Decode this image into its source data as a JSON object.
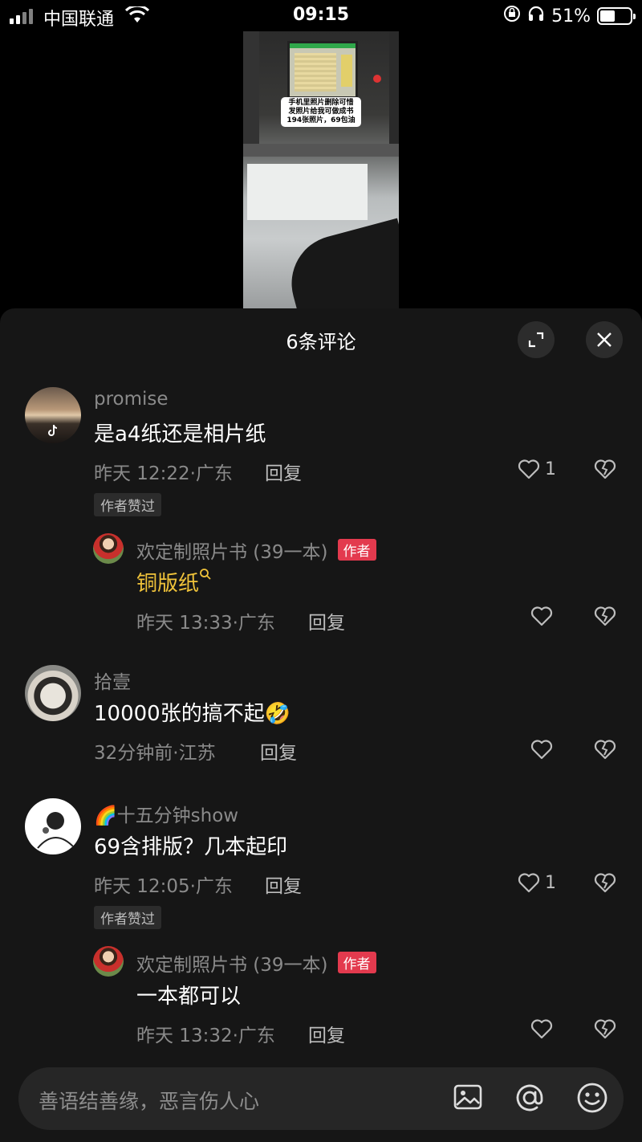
{
  "status_bar": {
    "carrier": "中国联通",
    "time": "09:15",
    "battery": "51%",
    "battery_level": 0.51
  },
  "video": {
    "caption_line1": "手机里照片删除可惜",
    "caption_line2": "发照片给我可做成书",
    "caption_line3": "194张照片，69包油"
  },
  "sheet": {
    "title": "6条评论"
  },
  "comments": [
    {
      "username": "promise",
      "text": "是a4纸还是相片纸",
      "meta": "昨天 12:22·广东",
      "reply_label": "回复",
      "likes": "1",
      "author_liked": "作者赞过",
      "replies": [
        {
          "username": "欢定制照片书 (39一本)",
          "badge": "作者",
          "text": "铜版纸",
          "meta": "昨天 13:33·广东",
          "reply_label": "回复"
        }
      ]
    },
    {
      "username": "拾壹",
      "text": "10000张的搞不起🤣",
      "meta": "32分钟前·江苏",
      "reply_label": "回复"
    },
    {
      "username": "🌈十五分钟show",
      "text": "69含排版？几本起印",
      "meta": "昨天 12:05·广东",
      "reply_label": "回复",
      "likes": "1",
      "author_liked": "作者赞过",
      "replies": [
        {
          "username": "欢定制照片书 (39一本)",
          "badge": "作者",
          "text": "一本都可以",
          "meta": "昨天 13:32·广东",
          "reply_label": "回复"
        }
      ]
    }
  ],
  "input": {
    "placeholder": "善语结善缘，恶言伤人心"
  }
}
